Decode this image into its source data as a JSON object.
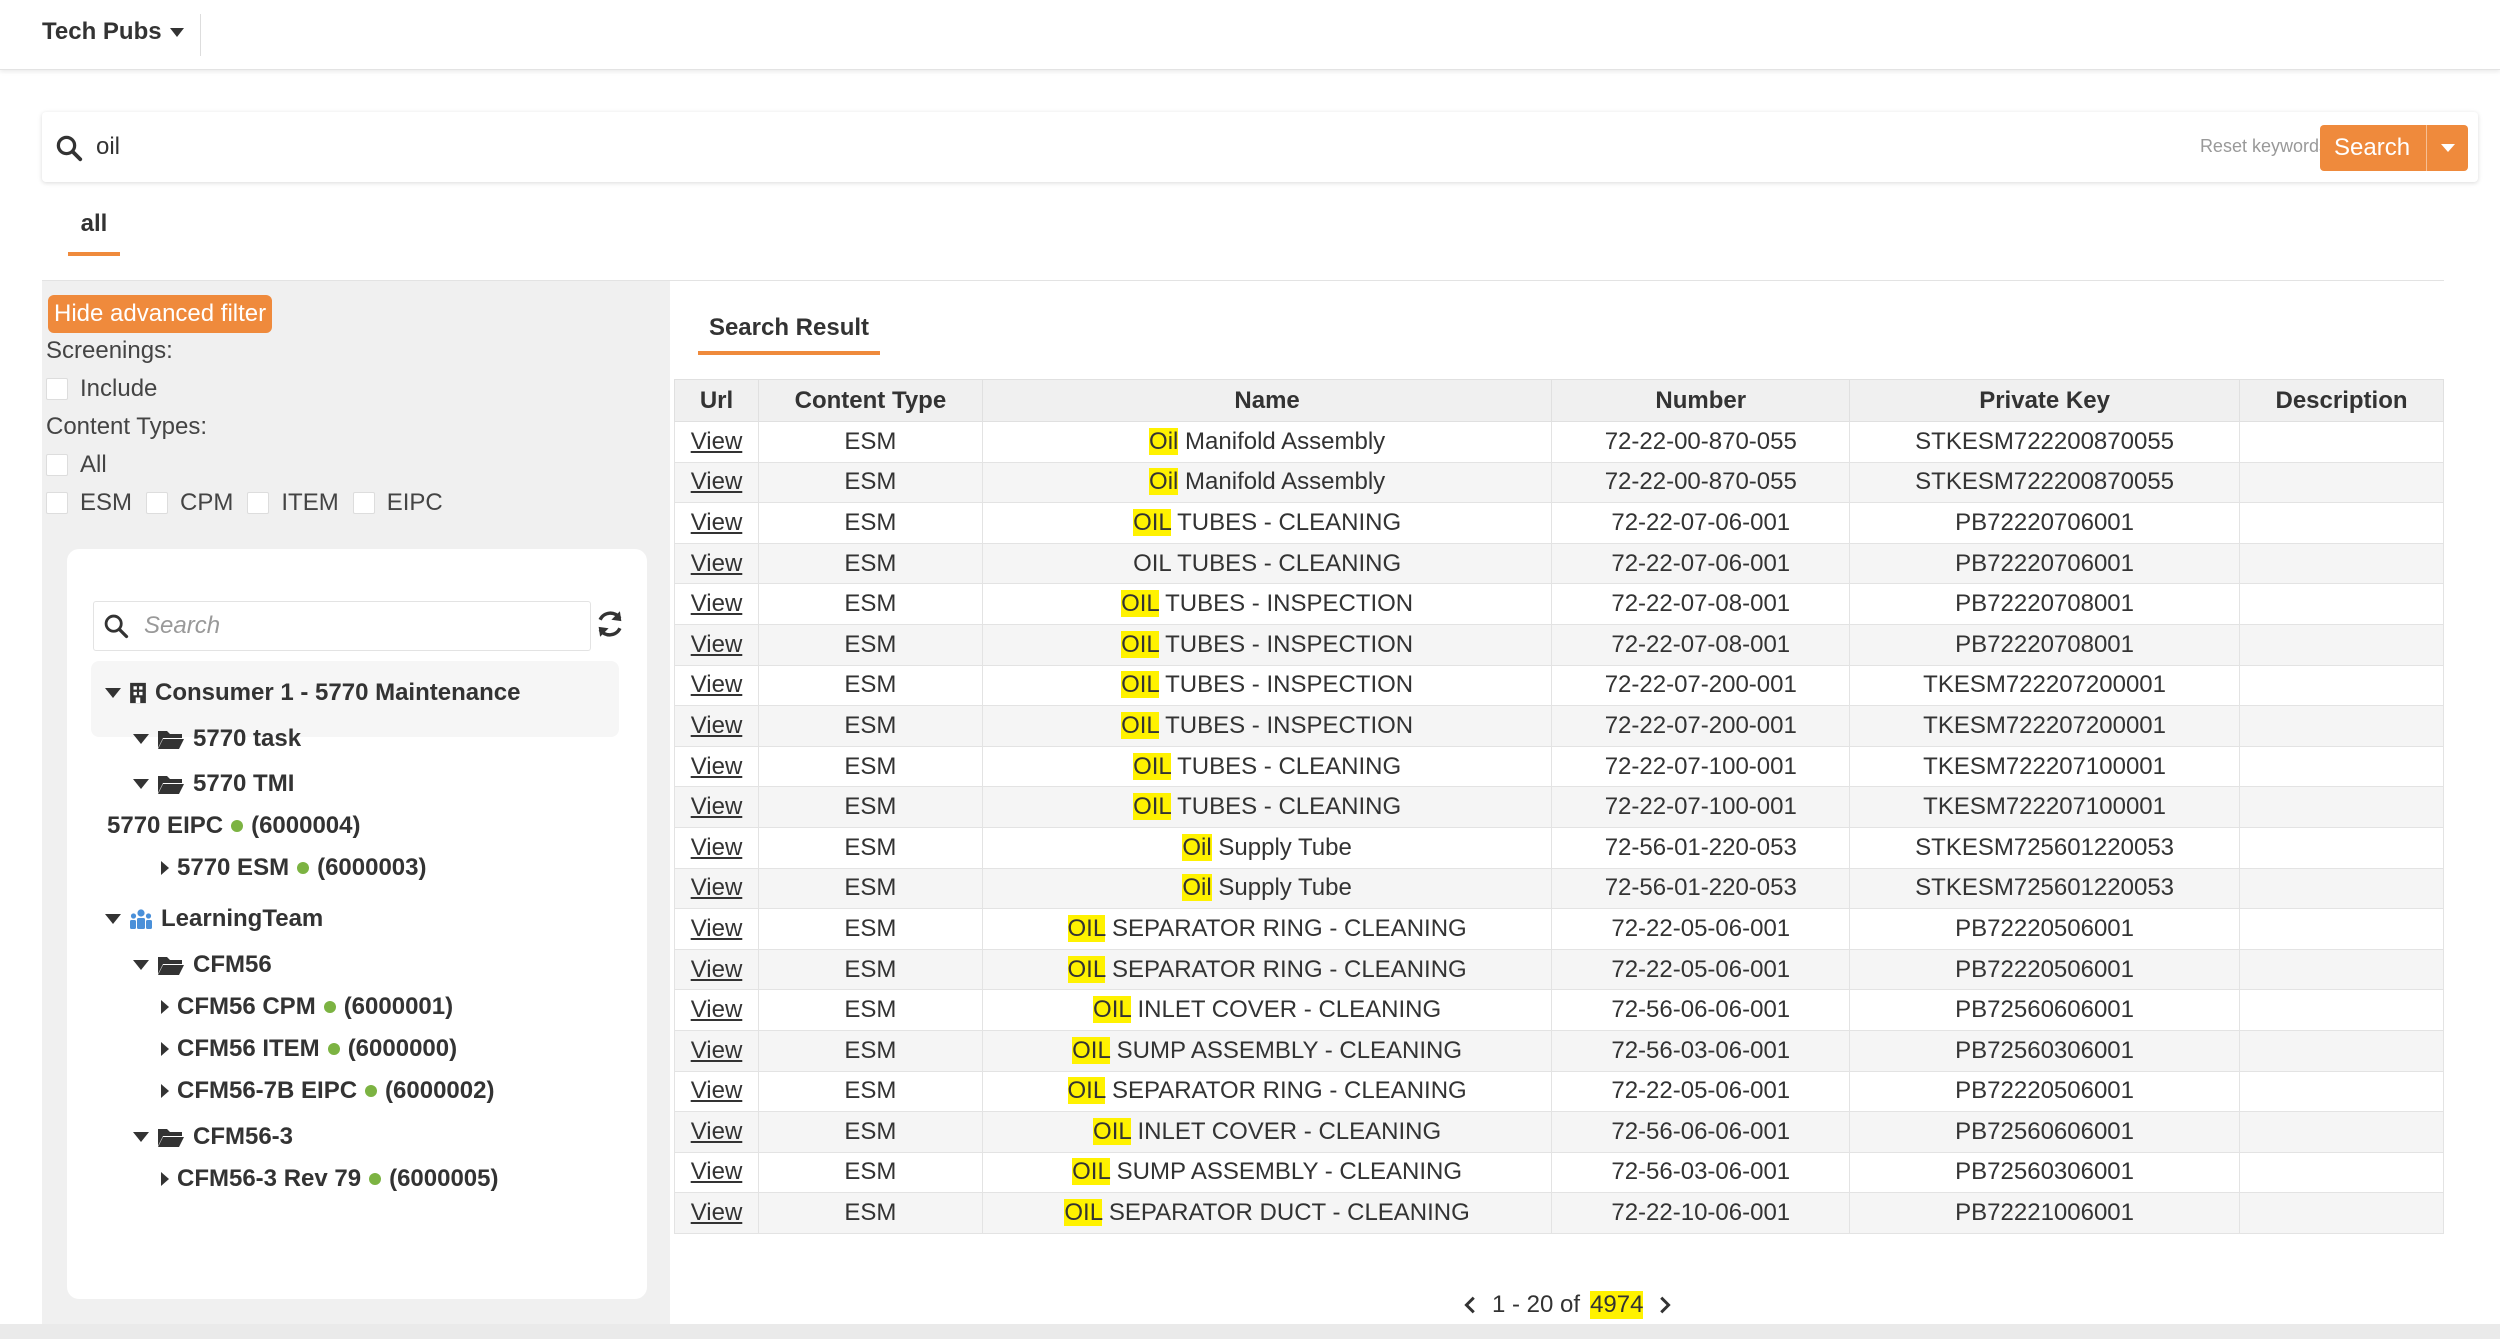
{
  "header": {
    "app_title": "Tech Pubs"
  },
  "search": {
    "value": "oil",
    "reset_label": "Reset keywords",
    "button_label": "Search"
  },
  "tabs": {
    "all": "all"
  },
  "filter": {
    "hide_button": "Hide advanced filter",
    "screenings_label": "Screenings:",
    "include_label": "Include",
    "content_types_label": "Content Types:",
    "all_label": "All",
    "types": [
      "ESM",
      "CPM",
      "ITEM",
      "EIPC"
    ]
  },
  "tree": {
    "search_placeholder": "Search",
    "consumer": "Consumer 1 - 5770 Maintenance",
    "task": "5770 task",
    "tmi": "5770 TMI",
    "eipc_label": "5770 EIPC",
    "eipc_id": "(6000004)",
    "esm_label": "5770 ESM",
    "esm_id": "(6000003)",
    "team": "LearningTeam",
    "cfm56": "CFM56",
    "cfm56_cpm": "CFM56 CPM",
    "cfm56_cpm_id": "(6000001)",
    "cfm56_item": "CFM56 ITEM",
    "cfm56_item_id": "(6000000)",
    "cfm56_7b": "CFM56-7B EIPC",
    "cfm56_7b_id": "(6000002)",
    "cfm56_3": "CFM56-3",
    "cfm56_3_rev": "CFM56-3 Rev 79",
    "cfm56_3_rev_id": "(6000005)"
  },
  "results": {
    "tab_label": "Search Result",
    "columns": [
      "Url",
      "Content Type",
      "Name",
      "Number",
      "Private Key",
      "Description"
    ],
    "rows": [
      {
        "url": "View",
        "type": "ESM",
        "hl": "Oil",
        "rest": " Manifold Assembly",
        "number": "72-22-00-870-055",
        "key": "STKESM722200870055",
        "desc": ""
      },
      {
        "url": "View",
        "type": "ESM",
        "hl": "Oil",
        "rest": " Manifold Assembly",
        "number": "72-22-00-870-055",
        "key": "STKESM722200870055",
        "desc": ""
      },
      {
        "url": "View",
        "type": "ESM",
        "hl": "OIL",
        "rest": " TUBES - CLEANING",
        "number": "72-22-07-06-001",
        "key": "PB72220706001",
        "desc": ""
      },
      {
        "url": "View",
        "type": "ESM",
        "hl": "",
        "rest": "OIL TUBES - CLEANING",
        "number": "72-22-07-06-001",
        "key": "PB72220706001",
        "desc": ""
      },
      {
        "url": "View",
        "type": "ESM",
        "hl": "OIL",
        "rest": " TUBES - INSPECTION",
        "number": "72-22-07-08-001",
        "key": "PB72220708001",
        "desc": ""
      },
      {
        "url": "View",
        "type": "ESM",
        "hl": "OIL",
        "rest": " TUBES - INSPECTION",
        "number": "72-22-07-08-001",
        "key": "PB72220708001",
        "desc": ""
      },
      {
        "url": "View",
        "type": "ESM",
        "hl": "OIL",
        "rest": " TUBES - INSPECTION",
        "number": "72-22-07-200-001",
        "key": "TKESM722207200001",
        "desc": ""
      },
      {
        "url": "View",
        "type": "ESM",
        "hl": "OIL",
        "rest": " TUBES - INSPECTION",
        "number": "72-22-07-200-001",
        "key": "TKESM722207200001",
        "desc": ""
      },
      {
        "url": "View",
        "type": "ESM",
        "hl": "OIL",
        "rest": " TUBES - CLEANING",
        "number": "72-22-07-100-001",
        "key": "TKESM722207100001",
        "desc": ""
      },
      {
        "url": "View",
        "type": "ESM",
        "hl": "OIL",
        "rest": " TUBES - CLEANING",
        "number": "72-22-07-100-001",
        "key": "TKESM722207100001",
        "desc": ""
      },
      {
        "url": "View",
        "type": "ESM",
        "hl": "Oil",
        "rest": " Supply Tube",
        "number": "72-56-01-220-053",
        "key": "STKESM725601220053",
        "desc": ""
      },
      {
        "url": "View",
        "type": "ESM",
        "hl": "Oil",
        "rest": " Supply Tube",
        "number": "72-56-01-220-053",
        "key": "STKESM725601220053",
        "desc": ""
      },
      {
        "url": "View",
        "type": "ESM",
        "hl": "OIL",
        "rest": " SEPARATOR RING - CLEANING",
        "number": "72-22-05-06-001",
        "key": "PB72220506001",
        "desc": ""
      },
      {
        "url": "View",
        "type": "ESM",
        "hl": "OIL",
        "rest": " SEPARATOR RING - CLEANING",
        "number": "72-22-05-06-001",
        "key": "PB72220506001",
        "desc": ""
      },
      {
        "url": "View",
        "type": "ESM",
        "hl": "OIL",
        "rest": " INLET COVER - CLEANING",
        "number": "72-56-06-06-001",
        "key": "PB72560606001",
        "desc": ""
      },
      {
        "url": "View",
        "type": "ESM",
        "hl": "OIL",
        "rest": " SUMP ASSEMBLY - CLEANING",
        "number": "72-56-03-06-001",
        "key": "PB72560306001",
        "desc": ""
      },
      {
        "url": "View",
        "type": "ESM",
        "hl": "OIL",
        "rest": " SEPARATOR RING - CLEANING",
        "number": "72-22-05-06-001",
        "key": "PB72220506001",
        "desc": ""
      },
      {
        "url": "View",
        "type": "ESM",
        "hl": "OIL",
        "rest": " INLET COVER - CLEANING",
        "number": "72-56-06-06-001",
        "key": "PB72560606001",
        "desc": ""
      },
      {
        "url": "View",
        "type": "ESM",
        "hl": "OIL",
        "rest": " SUMP ASSEMBLY - CLEANING",
        "number": "72-56-03-06-001",
        "key": "PB72560306001",
        "desc": ""
      },
      {
        "url": "View",
        "type": "ESM",
        "hl": "OIL",
        "rest": " SEPARATOR DUCT - CLEANING",
        "number": "72-22-10-06-001",
        "key": "PB72221006001",
        "desc": ""
      }
    ]
  },
  "pagination": {
    "range": "1 - 20 of",
    "total": "4974"
  },
  "colors": {
    "accent": "#ef8a3c",
    "highlight": "#fff200",
    "status_dot": "#7cb342",
    "team_icon": "#4a90d9"
  }
}
